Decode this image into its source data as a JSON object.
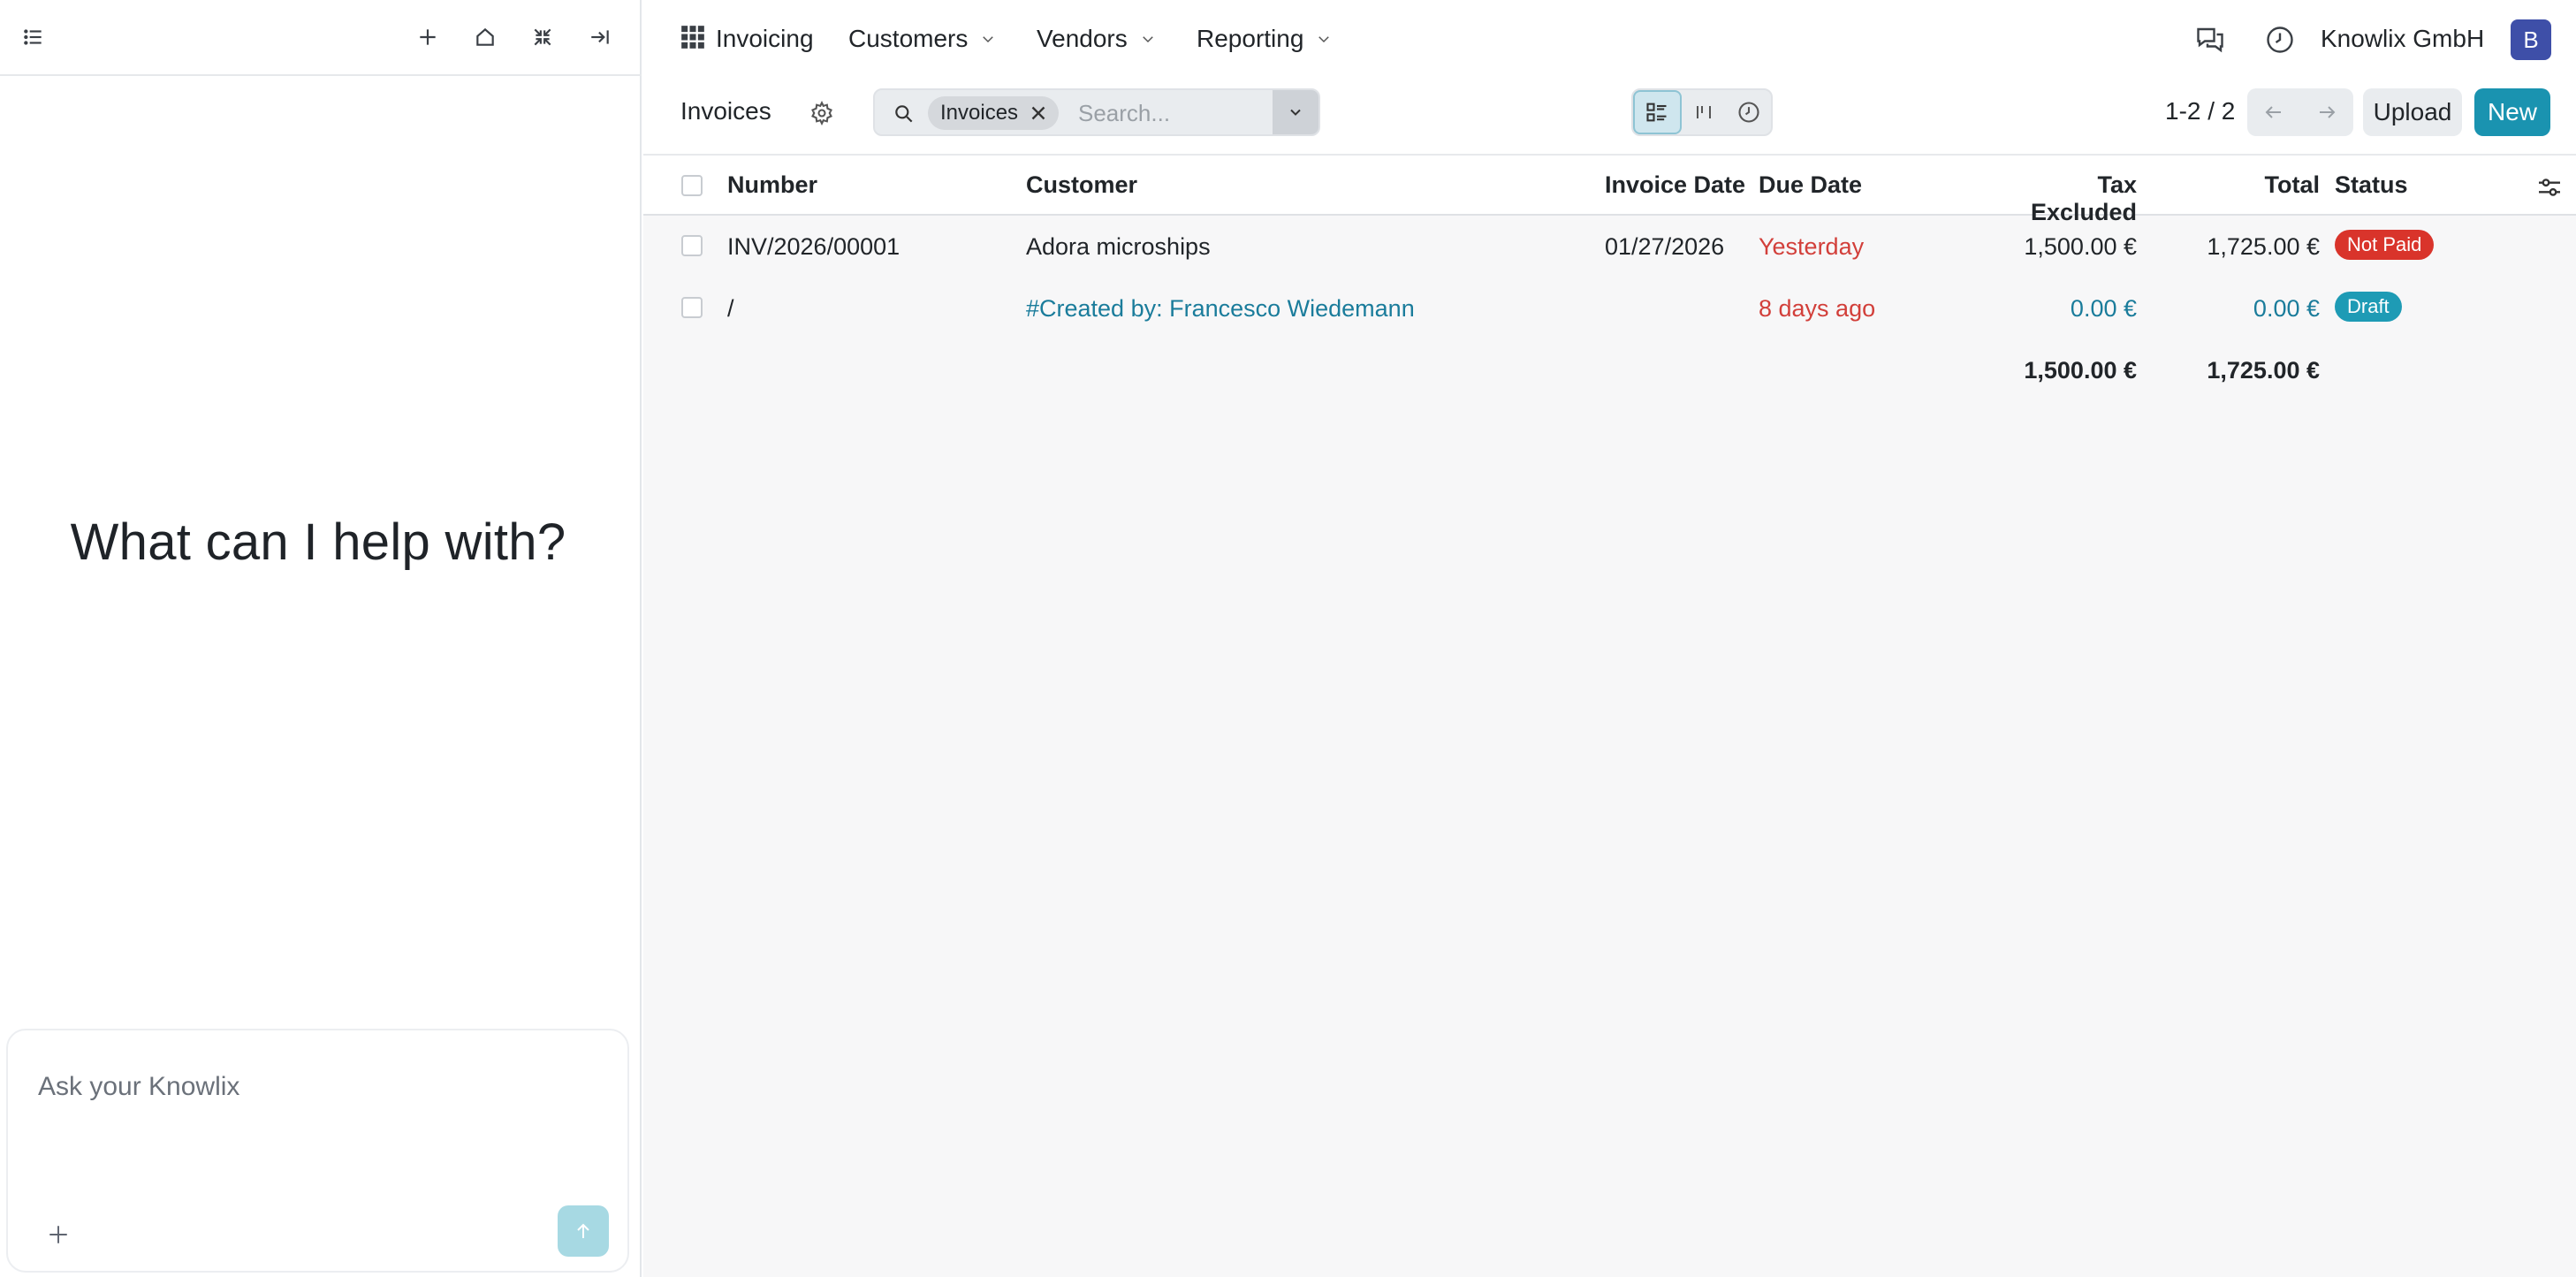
{
  "assistant": {
    "headline": "What can I help with?",
    "input_placeholder": "Ask your Knowlix"
  },
  "topbar": {
    "app_name": "Invoicing",
    "menus": [
      "Customers",
      "Vendors",
      "Reporting"
    ],
    "company": "Knowlix GmbH",
    "avatar_initial": "B"
  },
  "controls": {
    "breadcrumb": "Invoices",
    "search_facet": "Invoices",
    "search_placeholder": "Search...",
    "pager": "1-2 / 2",
    "upload_label": "Upload",
    "new_label": "New"
  },
  "table": {
    "headers": {
      "number": "Number",
      "customer": "Customer",
      "invoice_date": "Invoice Date",
      "due_date": "Due Date",
      "tax_excluded": "Tax Excluded",
      "total": "Total",
      "status": "Status"
    },
    "rows": [
      {
        "number": "INV/2026/00001",
        "customer": "Adora microships",
        "invoice_date": "01/27/2026",
        "due_date": "Yesterday",
        "tax_excluded": "1,500.00 €",
        "total": "1,725.00 €",
        "status": "Not Paid"
      },
      {
        "number": "/",
        "customer": "#Created by: Francesco Wiedemann",
        "invoice_date": "",
        "due_date": "8 days ago",
        "tax_excluded": "0.00 €",
        "total": "0.00 €",
        "status": "Draft"
      }
    ],
    "totals": {
      "tax_excluded": "1,500.00 €",
      "total": "1,725.00 €"
    }
  },
  "colors": {
    "accent": "#1a93b0",
    "status_not_paid": "#d9342b",
    "status_draft": "#1e9bb5",
    "overdue_text": "#d23f3a",
    "avatar": "#3e4fa8"
  }
}
